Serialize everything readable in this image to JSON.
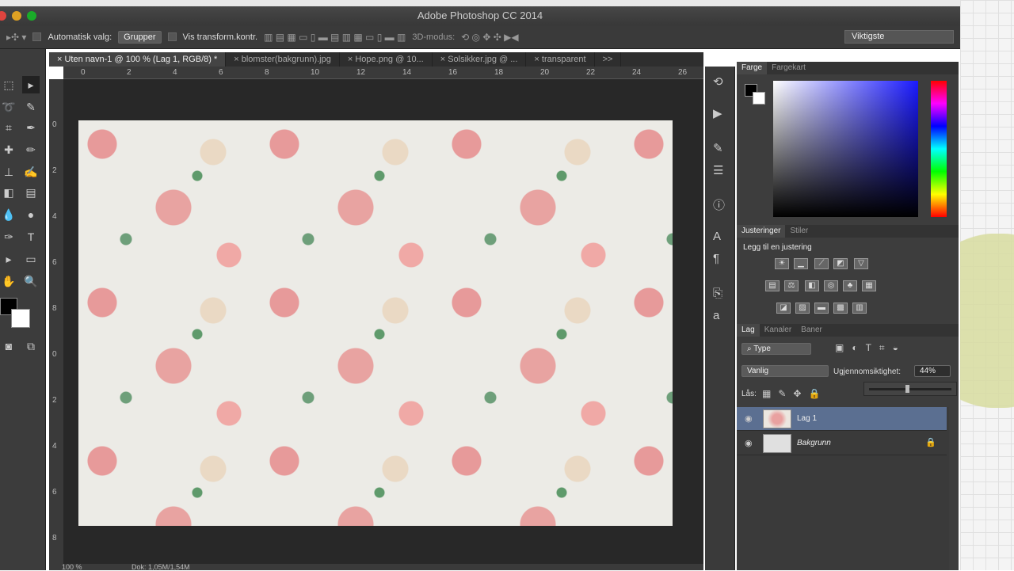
{
  "window": {
    "title": "Adobe Photoshop CC 2014"
  },
  "options": {
    "auto_select_label": "Automatisk valg:",
    "auto_select_value": "Grupper",
    "show_transform_label": "Vis transform.kontr.",
    "mode_3d_label": "3D-modus:",
    "workspace": "Viktigste"
  },
  "tabs": [
    {
      "label": "Uten navn-1 @ 100 % (Lag 1, RGB/8) *"
    },
    {
      "label": "blomster(bakgrunn).jpg"
    },
    {
      "label": "Hope.png @ 10..."
    },
    {
      "label": "Solsikker.jpg @ ..."
    },
    {
      "label": "transparent"
    }
  ],
  "tabs_overflow": ">>",
  "ruler_h": [
    "0",
    "2",
    "4",
    "6",
    "8",
    "10",
    "12",
    "14",
    "16",
    "18",
    "20",
    "22",
    "24",
    "26"
  ],
  "ruler_v": [
    "0",
    "2",
    "4",
    "6",
    "8",
    "0",
    "2",
    "4",
    "6",
    "8"
  ],
  "status": {
    "zoom": "100 %",
    "doc": "Dok: 1,05M/1,54M"
  },
  "color_panel": {
    "tabs": [
      "Farge",
      "Fargekart"
    ],
    "foreground": "#000000",
    "background": "#ffffff"
  },
  "adjustments": {
    "tabs": [
      "Justeringer",
      "Stiler"
    ],
    "heading": "Legg til en justering"
  },
  "layers": {
    "tabs": [
      "Lag",
      "Kanaler",
      "Baner"
    ],
    "filter": "Type",
    "blend_mode": "Vanlig",
    "opacity_label": "Ugjennomsiktighet:",
    "opacity_value": "44%",
    "opacity_fraction": 0.44,
    "lock_label": "Lås:",
    "items": [
      {
        "name": "Lag 1",
        "selected": true
      },
      {
        "name": "Bakgrunn",
        "locked": true
      }
    ]
  }
}
